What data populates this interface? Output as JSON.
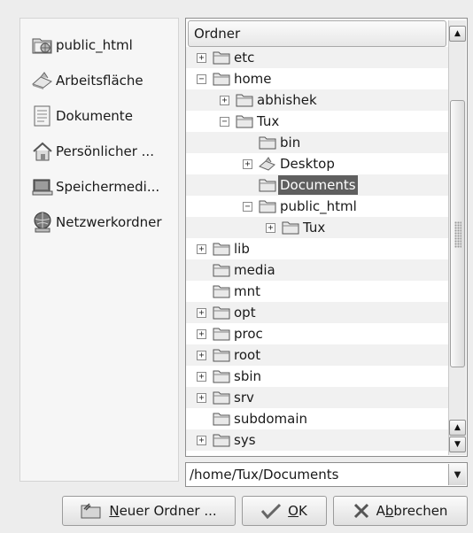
{
  "places": [
    {
      "label": "public_html",
      "icon": "folder-html-icon"
    },
    {
      "label": "Arbeitsfläche",
      "icon": "desktop-icon"
    },
    {
      "label": "Dokumente",
      "icon": "document-icon"
    },
    {
      "label": "Persönlicher ...",
      "icon": "home-icon"
    },
    {
      "label": "Speichermedi...",
      "icon": "storage-media-icon"
    },
    {
      "label": "Netzwerkordner",
      "icon": "network-folder-icon"
    }
  ],
  "tree": {
    "header": "Ordner",
    "rows": [
      {
        "label": "",
        "expander": "⊕"
      },
      {
        "label": "etc",
        "expander": "⊕"
      },
      {
        "label": "home",
        "expander": "⊖"
      },
      {
        "label": "abhishek",
        "expander": "⊕"
      },
      {
        "label": "Tux",
        "expander": "⊖"
      },
      {
        "label": "bin",
        "expander": ""
      },
      {
        "label": "Desktop",
        "expander": "⊕"
      },
      {
        "label": "Documents",
        "expander": "",
        "selected": true
      },
      {
        "label": "public_html",
        "expander": "⊖"
      },
      {
        "label": "Tux",
        "expander": "⊕"
      },
      {
        "label": "lib",
        "expander": "⊕"
      },
      {
        "label": "media",
        "expander": ""
      },
      {
        "label": "mnt",
        "expander": ""
      },
      {
        "label": "opt",
        "expander": "⊕"
      },
      {
        "label": "proc",
        "expander": "⊕"
      },
      {
        "label": "root",
        "expander": "⊕"
      },
      {
        "label": "sbin",
        "expander": "⊕"
      },
      {
        "label": "srv",
        "expander": "⊕"
      },
      {
        "label": "subdomain",
        "expander": ""
      },
      {
        "label": "sys",
        "expander": "⊕"
      }
    ]
  },
  "path_combo": {
    "value": "/home/Tux/Documents"
  },
  "buttons": {
    "new_folder": {
      "mnemonic": "N",
      "rest": "euer Ordner ..."
    },
    "ok": {
      "mnemonic": "O",
      "rest": "K"
    },
    "cancel": {
      "pre": "A",
      "mnemonic": "b",
      "rest": "brechen"
    }
  },
  "colors": {
    "selection": "#5f5f5f",
    "background": "#ededed"
  }
}
